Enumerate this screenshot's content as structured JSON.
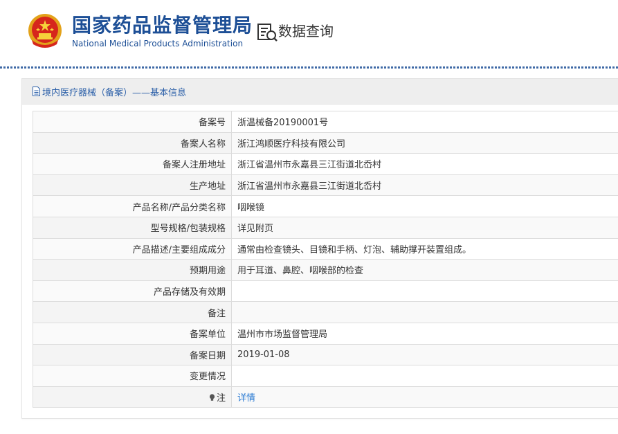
{
  "header": {
    "org_name_cn": "国家药品监督管理局",
    "org_name_en": "National Medical Products Administration",
    "query_label": "数据查询",
    "brand_color": "#1d4f96"
  },
  "panel": {
    "title": "境内医疗器械（备案）——基本信息"
  },
  "rows": [
    {
      "label": "备案号",
      "value": "浙温械备20190001号"
    },
    {
      "label": "备案人名称",
      "value": "浙江鸿顺医疗科技有限公司"
    },
    {
      "label": "备案人注册地址",
      "value": "浙江省温州市永嘉县三江街道北岙村"
    },
    {
      "label": "生产地址",
      "value": "浙江省温州市永嘉县三江街道北岙村"
    },
    {
      "label": "产品名称/产品分类名称",
      "value": "咽喉镜"
    },
    {
      "label": "型号规格/包装规格",
      "value": "详见附页"
    },
    {
      "label": "产品描述/主要组成成分",
      "value": "通常由检查镜头、目镜和手柄、灯泡、辅助撑开装置组成。"
    },
    {
      "label": "预期用途",
      "value": "用于耳道、鼻腔、咽喉部的检查"
    },
    {
      "label": "产品存储及有效期",
      "value": ""
    },
    {
      "label": "备注",
      "value": ""
    },
    {
      "label": "备案单位",
      "value": "温州市市场监督管理局"
    },
    {
      "label": "备案日期",
      "value": "2019-01-08"
    },
    {
      "label": "变更情况",
      "value": ""
    },
    {
      "label": "注",
      "value": "详情"
    }
  ]
}
